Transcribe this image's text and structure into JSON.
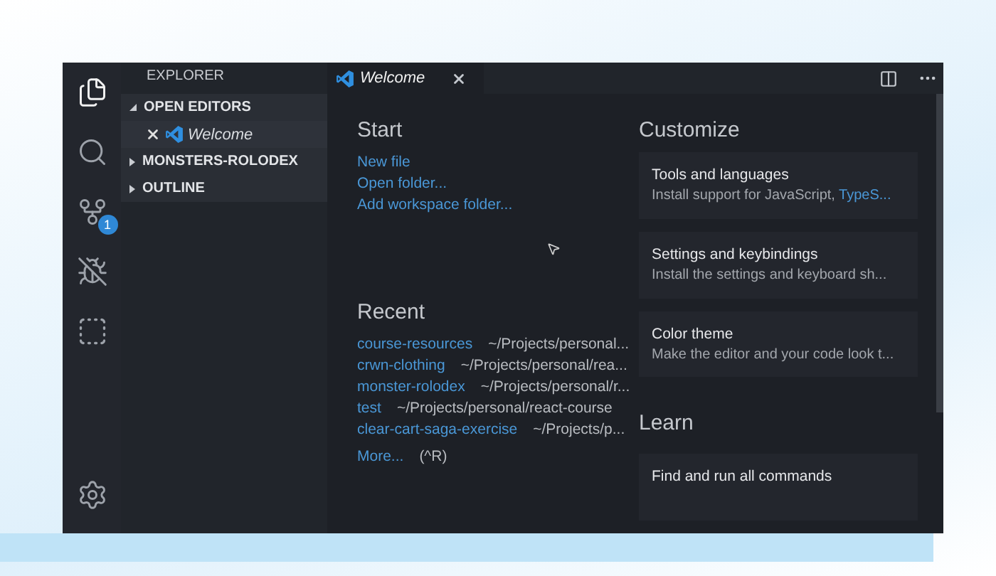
{
  "activity_bar": {
    "items": [
      {
        "kind": "files",
        "selected": true
      },
      {
        "kind": "search",
        "selected": false
      },
      {
        "kind": "source-control",
        "selected": false,
        "badge": "1"
      },
      {
        "kind": "debug",
        "selected": false
      },
      {
        "kind": "extensions",
        "selected": false
      }
    ]
  },
  "sidebar": {
    "title": "EXPLORER",
    "sections": [
      {
        "label": "OPEN EDITORS",
        "expanded": true,
        "children": [
          {
            "label": "Welcome",
            "selected": true
          }
        ]
      },
      {
        "label": "MONSTERS-ROLODEX",
        "expanded": false
      },
      {
        "label": "OUTLINE",
        "expanded": false
      }
    ]
  },
  "tabs": [
    {
      "label": "Welcome",
      "selected": true
    }
  ],
  "start": {
    "title": "Start",
    "links": [
      "New file",
      "Open folder...",
      "Add workspace folder..."
    ]
  },
  "recent": {
    "title": "Recent",
    "items": [
      {
        "name": "course-resources",
        "path": "~/Projects/personal..."
      },
      {
        "name": "crwn-clothing",
        "path": "~/Projects/personal/rea..."
      },
      {
        "name": "monster-rolodex",
        "path": "~/Projects/personal/r..."
      },
      {
        "name": "test",
        "path": "~/Projects/personal/react-course"
      },
      {
        "name": "clear-cart-saga-exercise",
        "path": "~/Projects/p..."
      }
    ],
    "more": {
      "label": "More...",
      "shortcut": "(^R)"
    }
  },
  "customize": {
    "title": "Customize",
    "cards": [
      {
        "title": "Tools and languages",
        "description": "Install support for JavaScript, ",
        "link": "TypeS..."
      },
      {
        "title": "Settings and keybindings",
        "description": "Install the settings and keyboard sh..."
      },
      {
        "title": "Color theme",
        "description": "Make the editor and your code look t..."
      }
    ]
  },
  "learn": {
    "title": "Learn",
    "cards": [
      {
        "title": "Find and run all commands"
      }
    ]
  }
}
